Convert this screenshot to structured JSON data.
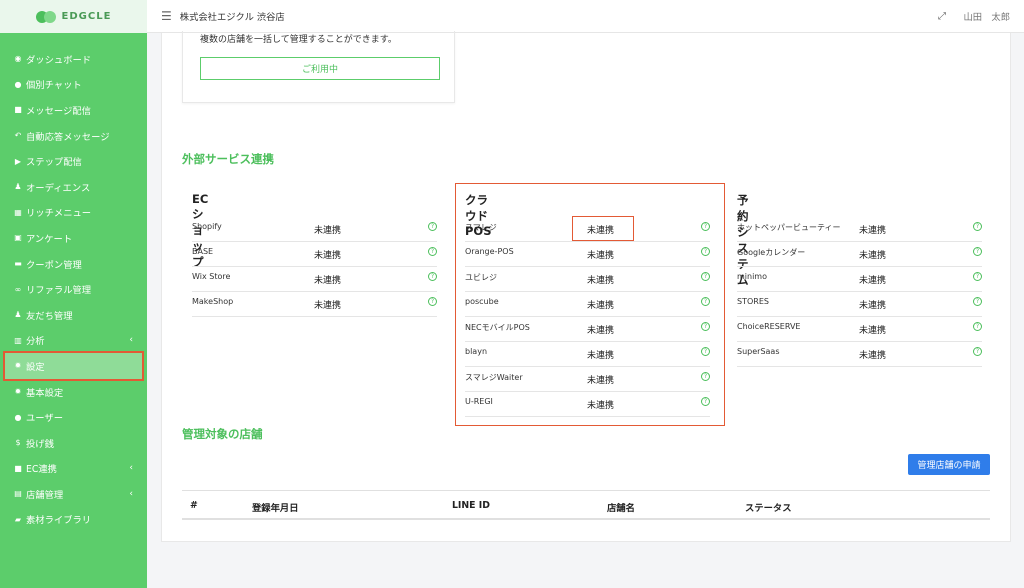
{
  "sidebar": {
    "logo_text": "EDGCLE",
    "items": [
      {
        "label": "ダッシュボード",
        "icon": "dashboard-icon",
        "glyph": "◉"
      },
      {
        "label": "個別チャット",
        "icon": "chat-icon",
        "glyph": "●"
      },
      {
        "label": "メッセージ配信",
        "icon": "message-icon",
        "glyph": "■"
      },
      {
        "label": "自動応答メッセージ",
        "icon": "reply-icon",
        "glyph": "↶"
      },
      {
        "label": "ステップ配信",
        "icon": "play-icon",
        "glyph": "▶"
      },
      {
        "label": "オーディエンス",
        "icon": "users-icon",
        "glyph": "♟"
      },
      {
        "label": "リッチメニュー",
        "icon": "grid-icon",
        "glyph": "▦"
      },
      {
        "label": "アンケート",
        "icon": "survey-icon",
        "glyph": "▣"
      },
      {
        "label": "クーポン管理",
        "icon": "coupon-icon",
        "glyph": "▬"
      },
      {
        "label": "リファラル管理",
        "icon": "link-icon",
        "glyph": "∞"
      },
      {
        "label": "友だち管理",
        "icon": "friends-icon",
        "glyph": "♟"
      },
      {
        "label": "分析",
        "icon": "chart-icon",
        "glyph": "▥",
        "arrow": "‹"
      },
      {
        "label": "設定",
        "icon": "gear-icon",
        "glyph": "✹",
        "active": true
      },
      {
        "label": "基本設定",
        "icon": "gear-icon",
        "glyph": "✹"
      },
      {
        "label": "ユーザー",
        "icon": "user-icon",
        "glyph": "●"
      },
      {
        "label": "投げ銭",
        "icon": "dollar-icon",
        "glyph": "$"
      },
      {
        "label": "EC連携",
        "icon": "bag-icon",
        "glyph": "■",
        "arrow": "‹"
      },
      {
        "label": "店舗管理",
        "icon": "store-icon",
        "glyph": "▤",
        "arrow": "‹"
      },
      {
        "label": "素材ライブラリ",
        "icon": "folder-icon",
        "glyph": "▰"
      }
    ]
  },
  "header": {
    "shop_name": "株式会社エジクル 渋谷店",
    "user_name": "山田　太郎"
  },
  "main": {
    "description": "複数の店舗を一括して管理することができます。",
    "in_use_label": "ご利用中",
    "external_title": "外部サービス連携",
    "columns": [
      {
        "title": "ECショップ",
        "rows": [
          {
            "service": "Shopify",
            "status": "未連携"
          },
          {
            "service": "BASE",
            "status": "未連携"
          },
          {
            "service": "Wix Store",
            "status": "未連携"
          },
          {
            "service": "MakeShop",
            "status": "未連携"
          }
        ]
      },
      {
        "title": "クラウドPOS",
        "rows": [
          {
            "service": "スマレジ",
            "status": "未連携"
          },
          {
            "service": "Orange-POS",
            "status": "未連携"
          },
          {
            "service": "ユビレジ",
            "status": "未連携"
          },
          {
            "service": "poscube",
            "status": "未連携"
          },
          {
            "service": "NECモバイルPOS",
            "status": "未連携"
          },
          {
            "service": "blayn",
            "status": "未連携"
          },
          {
            "service": "スマレジWaiter",
            "status": "未連携"
          },
          {
            "service": "U-REGI",
            "status": "未連携"
          }
        ]
      },
      {
        "title": "予約システム",
        "rows": [
          {
            "service": "ホットペッパービューティー",
            "status": "未連携"
          },
          {
            "service": "Googleカレンダー",
            "status": "未連携"
          },
          {
            "service": "minimo",
            "status": "未連携"
          },
          {
            "service": "STORES",
            "status": "未連携"
          },
          {
            "service": "ChoiceRESERVE",
            "status": "未連携"
          },
          {
            "service": "SuperSaas",
            "status": "未連携"
          }
        ]
      }
    ],
    "help_glyph": "?",
    "stores_title": "管理対象の店舗",
    "apply_label": "管理店舗の申請",
    "table_headers": [
      "#",
      "登録年月日",
      "LINE ID",
      "店舗名",
      "ステータス"
    ]
  },
  "colors": {
    "sidebar": "#5ccd6b",
    "accent_green": "#4cbf5c",
    "highlight": "#e35a35",
    "primary_button": "#2f7dea"
  }
}
